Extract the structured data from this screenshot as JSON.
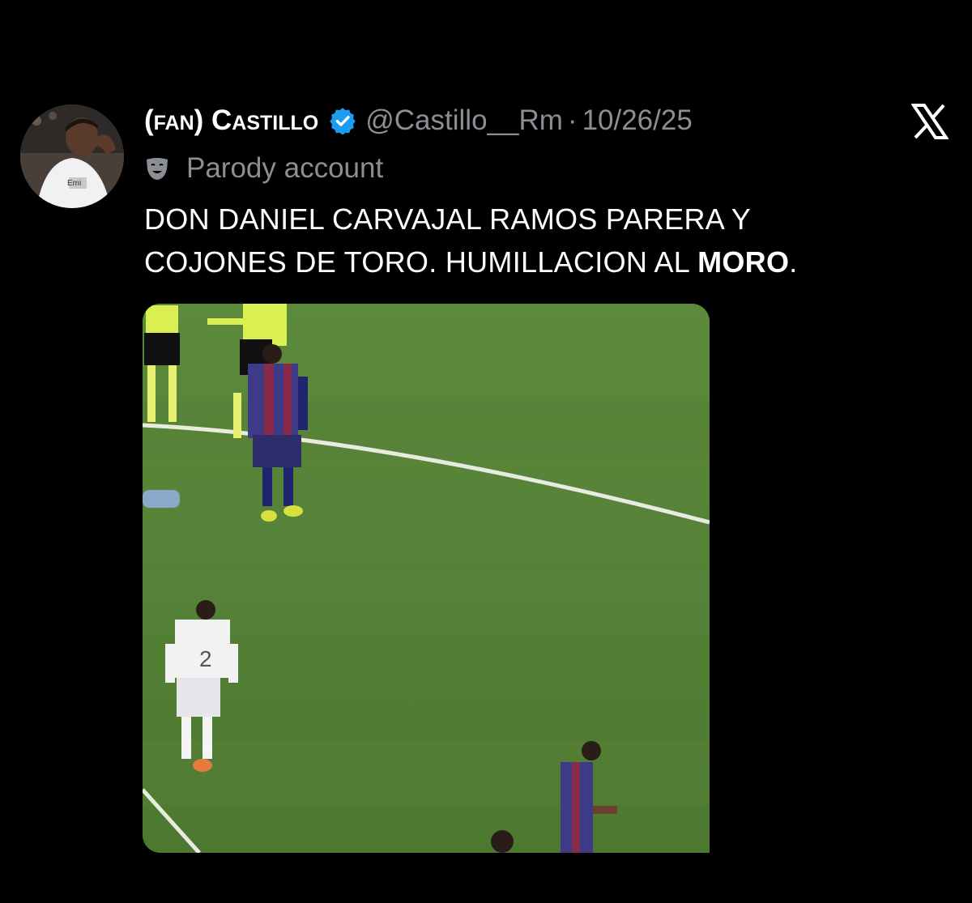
{
  "tweet": {
    "display_name": "(fan) Castillo",
    "handle": "@Castillo__Rm",
    "separator": "·",
    "date": "10/26/25",
    "parody_label": "Parody account",
    "text_line1": "DON DANIEL CARVAJAL RAMOS PARERA Y",
    "text_line2_part1": "COJONES DE TORO. HUMILLACION AL ",
    "text_line2_bold": "MORO",
    "text_line2_end": ".",
    "media_jersey_number": "2"
  },
  "icons": {
    "verified": "verified-badge-icon",
    "platform": "x-logo-icon",
    "parody": "theater-mask-icon"
  },
  "colors": {
    "background": "#000000",
    "text": "#ffffff",
    "secondary": "#8b8f94",
    "verified": "#1d9bf0",
    "pitch": "#4f7a32"
  }
}
